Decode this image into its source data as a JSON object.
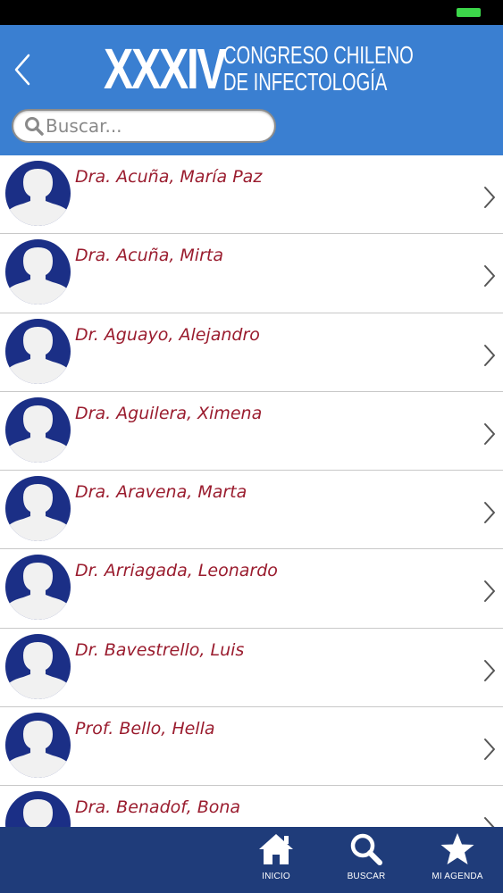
{
  "header": {
    "title_roman": "XXXIV",
    "title_line1": "CONGRESO CHILENO",
    "title_line2": "DE INFECTOLOGÍA",
    "back_icon": "chevron-left-icon"
  },
  "search": {
    "placeholder": "Buscar...",
    "value": ""
  },
  "speakers": [
    {
      "name": "Dra. Acuña, María Paz"
    },
    {
      "name": "Dra. Acuña, Mirta"
    },
    {
      "name": "Dr. Aguayo, Alejandro"
    },
    {
      "name": "Dra. Aguilera, Ximena"
    },
    {
      "name": "Dra. Aravena, Marta"
    },
    {
      "name": "Dr. Arriagada, Leonardo"
    },
    {
      "name": "Dr. Bavestrello, Luis"
    },
    {
      "name": "Prof. Bello, Hella"
    },
    {
      "name": "Dra. Benadof, Bona"
    }
  ],
  "tabbar": {
    "tabs": [
      {
        "label": "INICIO",
        "icon": "home-icon"
      },
      {
        "label": "BUSCAR",
        "icon": "search-icon"
      },
      {
        "label": "MI AGENDA",
        "icon": "star-icon"
      }
    ]
  },
  "colors": {
    "header_bg": "#3a7fd1",
    "tabbar_bg": "#1f3c7a",
    "name_text": "#9a1c2e",
    "avatar_blue": "#1b2f86",
    "battery": "#3cd74a"
  }
}
